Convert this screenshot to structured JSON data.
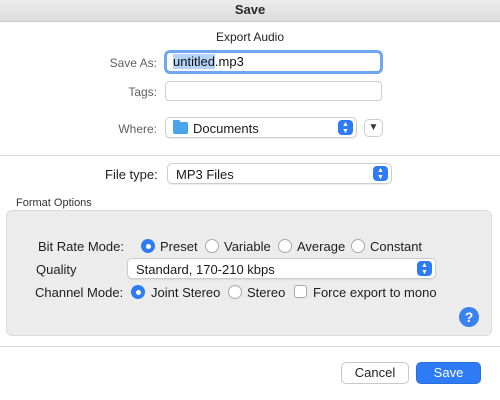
{
  "window": {
    "title": "Save"
  },
  "dialog": {
    "title": "Export Audio"
  },
  "save_as": {
    "label": "Save As:",
    "value_selected": "untitled",
    "value_rest": ".mp3"
  },
  "tags": {
    "label": "Tags:",
    "value": ""
  },
  "where": {
    "label": "Where:",
    "value": "Documents",
    "icon": "folder-icon",
    "expand_icon": "chevron-down-icon"
  },
  "file_type": {
    "label": "File type:",
    "value": "MP3 Files"
  },
  "format_options": {
    "title": "Format Options",
    "bit_rate_mode": {
      "label": "Bit Rate Mode:",
      "options": [
        "Preset",
        "Variable",
        "Average",
        "Constant"
      ],
      "selected": "Preset"
    },
    "quality": {
      "label": "Quality",
      "value": "Standard, 170-210 kbps"
    },
    "channel_mode": {
      "label": "Channel Mode:",
      "options": [
        "Joint Stereo",
        "Stereo"
      ],
      "selected": "Joint Stereo",
      "force_mono_label": "Force export to mono",
      "force_mono_checked": false
    }
  },
  "help": {
    "symbol": "?"
  },
  "buttons": {
    "cancel": "Cancel",
    "save": "Save"
  },
  "colors": {
    "accent": "#2f7bf6",
    "focus_ring": "#6fa8f0"
  }
}
